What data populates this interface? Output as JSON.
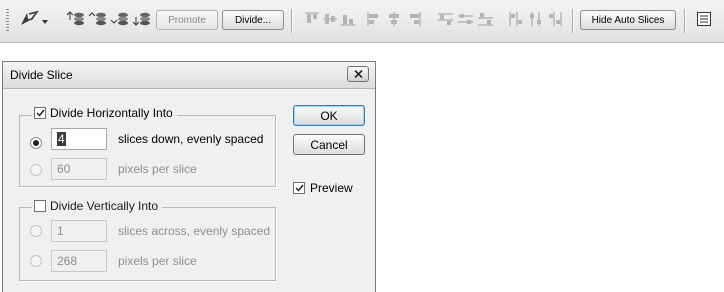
{
  "toolbar": {
    "buttons": {
      "promote": "Promote",
      "divide": "Divide...",
      "hide_auto_slices": "Hide Auto Slices"
    },
    "icons": {
      "tool": "slice-select-tool-icon",
      "stack": [
        "bring-to-front-icon",
        "bring-forward-icon",
        "send-backward-icon",
        "send-to-back-icon"
      ],
      "align": [
        "align-top-edges-icon",
        "align-vertical-centers-icon",
        "align-bottom-edges-icon",
        "align-left-edges-icon",
        "align-horizontal-centers-icon",
        "align-right-edges-icon"
      ],
      "distribute": [
        "distribute-top-icon",
        "distribute-vertical-centers-icon",
        "distribute-bottom-icon",
        "distribute-left-icon",
        "distribute-horizontal-centers-icon",
        "distribute-right-icon"
      ],
      "options": "slice-options-icon"
    }
  },
  "dialog": {
    "title": "Divide Slice",
    "horizontal": {
      "label": "Divide Horizontally Into",
      "checked": true,
      "slices_value": "4",
      "slices_label": "slices down, evenly spaced",
      "pixels_value": "60",
      "pixels_label": "pixels per slice"
    },
    "vertical": {
      "label": "Divide Vertically Into",
      "checked": false,
      "slices_value": "1",
      "slices_label": "slices across, evenly spaced",
      "pixels_value": "268",
      "pixels_label": "pixels per slice"
    },
    "ok": "OK",
    "cancel": "Cancel",
    "preview": {
      "label": "Preview",
      "checked": true
    }
  },
  "colors": {
    "accent_border": "#3c7fb1",
    "disabled_text": "#8f8f8f"
  }
}
